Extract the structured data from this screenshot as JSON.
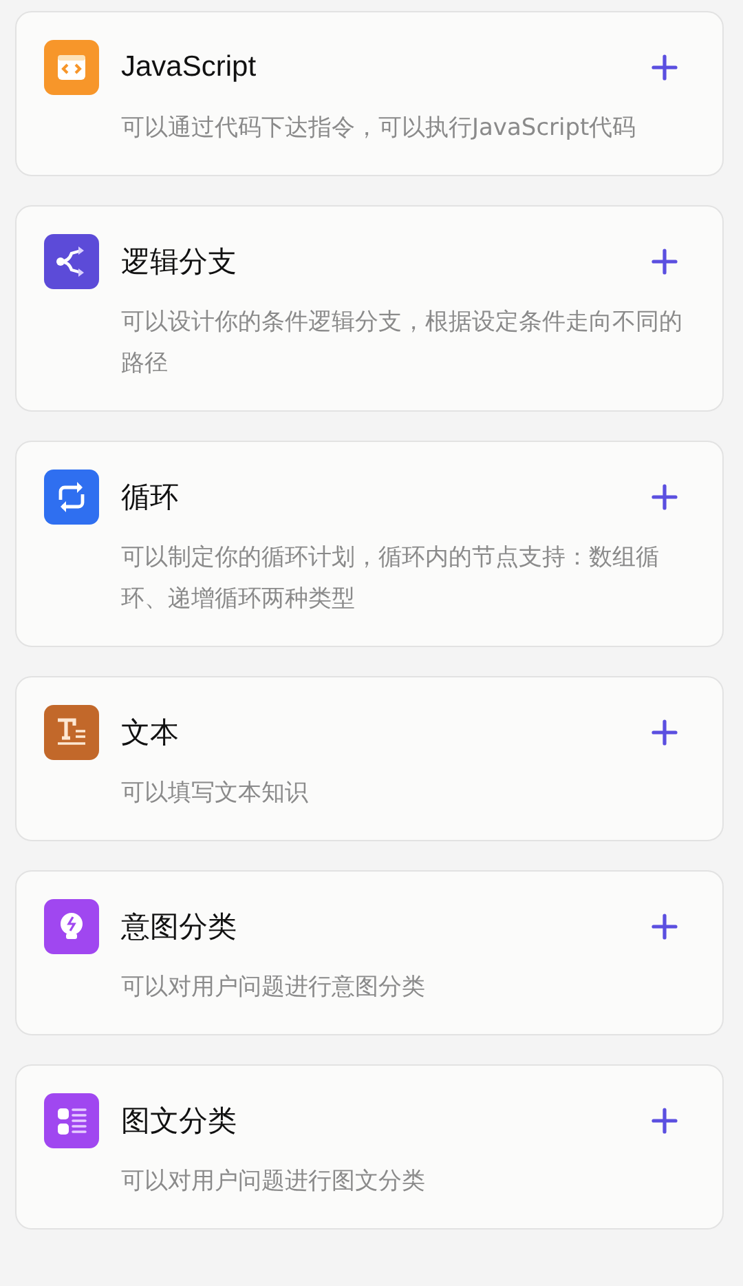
{
  "nodes": [
    {
      "kind": "code",
      "color": "#f7962a",
      "title": "JavaScript",
      "description": "可以通过代码下达指令，可以执行JavaScript代码"
    },
    {
      "kind": "branch",
      "color": "#5c4bd8",
      "title": "逻辑分支",
      "description": "可以设计你的条件逻辑分支，根据设定条件走向不同的路径"
    },
    {
      "kind": "loop",
      "color": "#2f6ff0",
      "title": "循环",
      "description": "可以制定你的循环计划，循环内的节点支持：数组循环、递增循环两种类型"
    },
    {
      "kind": "text",
      "color": "#c2682a",
      "title": "文本",
      "description": "可以填写文本知识"
    },
    {
      "kind": "intent",
      "color": "#a047f0",
      "title": "意图分类",
      "description": "可以对用户问题进行意图分类"
    },
    {
      "kind": "classify",
      "color": "#a047f0",
      "title": "图文分类",
      "description": "可以对用户问题进行图文分类"
    }
  ]
}
